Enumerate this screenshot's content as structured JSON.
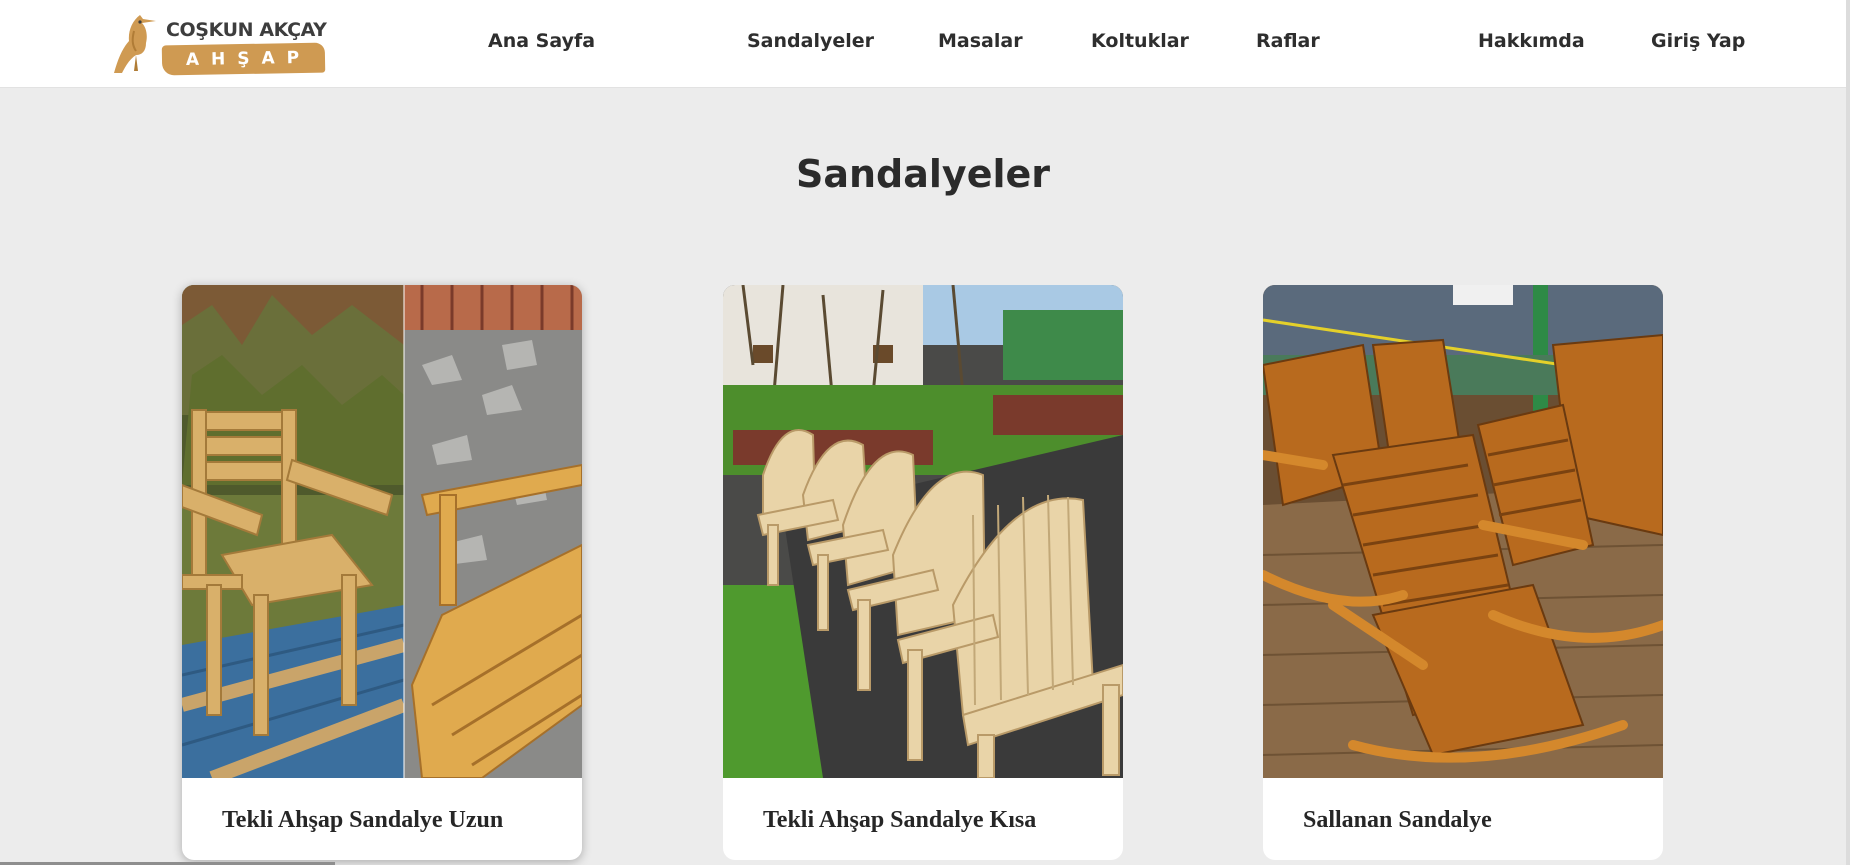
{
  "brand": {
    "name": "COŞKUN AKÇAY",
    "word": "AHŞAP",
    "colors": {
      "accent": "#cf9a52",
      "text": "#3d3d3d"
    }
  },
  "nav": {
    "home": "Ana Sayfa",
    "chairs": "Sandalyeler",
    "tables": "Masalar",
    "armchairs": "Koltuklar",
    "shelves": "Raflar",
    "about": "Hakkımda",
    "login": "Giriş Yap"
  },
  "page": {
    "title": "Sandalyeler",
    "background": "#ececec"
  },
  "products": [
    {
      "title": "Tekli Ahşap Sandalye Uzun",
      "image": "wooden-armchair-collage-photo"
    },
    {
      "title": "Tekli Ahşap Sandalye Kısa",
      "image": "row-of-adirondack-chairs-photo"
    },
    {
      "title": "Sallanan Sandalye",
      "image": "varnished-rocking-chairs-photo"
    }
  ]
}
